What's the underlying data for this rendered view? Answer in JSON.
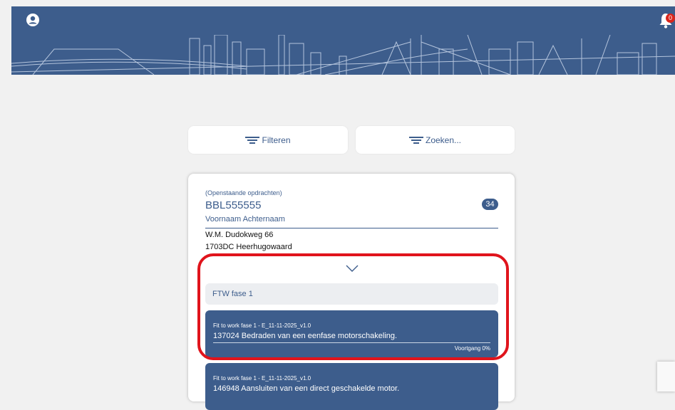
{
  "header": {
    "notification_count": "0"
  },
  "actions": {
    "filter_label": "Filteren",
    "search_label": "Zoeken..."
  },
  "card": {
    "subtitle": "(Openstaande opdrachten)",
    "code": "BBL555555",
    "count": "34",
    "name": "Voornaam Achternaam",
    "address_line1": "W.M. Dudokweg 66",
    "address_line2": "1703DC Heerhugowaard",
    "phase_label": "FTW fase 1",
    "tasks": [
      {
        "subtitle": "Fit to work fase 1 - E_11-11-2025_v1.0",
        "title": "137024 Bedraden van een eenfase motorschakeling.",
        "progress": "Voortgang 0%"
      },
      {
        "subtitle": "Fit to work fase 1 - E_11-11-2025_v1.0",
        "title": "146948 Aansluiten van een direct geschakelde motor."
      }
    ]
  },
  "colors": {
    "primary": "#3d5d8c",
    "highlight": "#e0141c",
    "badge": "#d9261c"
  },
  "icons": {
    "profile": "user-circle-icon",
    "notifications": "bell-icon",
    "filter": "filter-lines-icon",
    "search": "filter-lines-icon",
    "expand": "chevron-down-icon"
  }
}
